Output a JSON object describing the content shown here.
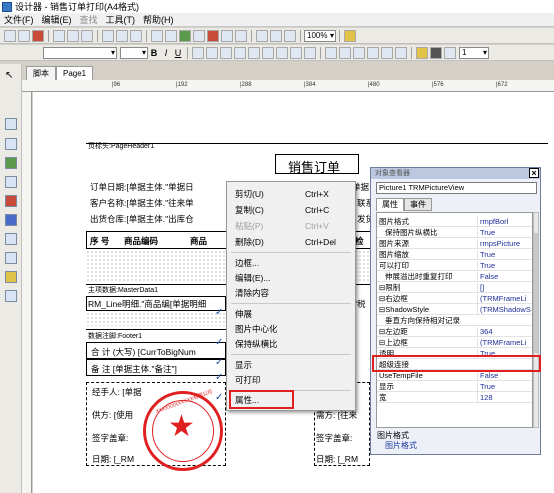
{
  "window": {
    "title": "设计器 - 销售订单打印(A4格式)"
  },
  "menu": {
    "items": [
      "文件(F)",
      "编辑(E)",
      "查找",
      "工具(T)",
      "帮助(H)"
    ]
  },
  "toolbar": {
    "zoom": "100%",
    "size": "1"
  },
  "tabs": [
    "脚本",
    "Page1"
  ],
  "ruler": {
    "marks": [
      "|96",
      "|192",
      "|288",
      "|384",
      "|480",
      "|576",
      "|672"
    ]
  },
  "report": {
    "page_header": "页标头:PageHeader1",
    "title": "销售订单",
    "fields": {
      "order_date": "订单日期:[单据主体.\"单据日",
      "customer": "客户名称:[单据主体.\"往来单",
      "warehouse": "出货仓库:[单据主体.\"出库仓",
      "r1": "单据",
      "r2": "联系",
      "r3": "发货"
    },
    "table_headers": [
      "序 号",
      "商品编码",
      "商品",
      "检"
    ],
    "master_band": "主项数据:MasterData1",
    "master_row": "RM_Line明细.\"商品编[单据明细",
    "master_tax": "\"税",
    "footer_band": "数据注脚:Footer1",
    "total": "合 计 (大写) [CurrToBigNum",
    "remark": "备 注 [单据主体.\"备注\"]",
    "handler": "经手人: [单据",
    "supplier": "供方: [使用",
    "demand": "需方: [往来",
    "sign1": "签字盖章:",
    "sign2": "签字盖章:",
    "date1": "日期: [_RM",
    "date2": "日期: [_RM",
    "stamp_text": "XXXXXXXXXXXX有限公司"
  },
  "context_menu": {
    "items": [
      {
        "label": "剪切(U)",
        "shortcut": "Ctrl+X"
      },
      {
        "label": "复制(C)",
        "shortcut": "Ctrl+C"
      },
      {
        "label": "粘贴(P)",
        "shortcut": "Ctrl+V"
      },
      {
        "label": "删除(D)",
        "shortcut": "Ctrl+Del"
      },
      {
        "label": "边框..."
      },
      {
        "label": "编辑(E)..."
      },
      {
        "label": "清除内容"
      },
      {
        "label": "伸展"
      },
      {
        "label": "图片中心化"
      },
      {
        "label": "保持纵横比"
      },
      {
        "label": "显示"
      },
      {
        "label": "可打印"
      },
      {
        "label": "属性..."
      }
    ]
  },
  "inspector": {
    "title": "对象查看器",
    "object": "Picture1    TRMPictureView",
    "tabs": [
      "属性",
      "事件"
    ],
    "rows": [
      {
        "name": "图片格式",
        "value": "rmpfBorl"
      },
      {
        "name": "保持图片纵横比",
        "value": "True"
      },
      {
        "name": "图片来源",
        "value": "rmpsPicture"
      },
      {
        "name": "图片缩放",
        "value": "True"
      },
      {
        "name": "可以打印",
        "value": "True"
      },
      {
        "name": "伸展溢出时重复打印",
        "value": "False"
      },
      {
        "name": "⊟限制",
        "value": "[]"
      },
      {
        "name": "⊟右边框",
        "value": "(TRMFrameLi"
      },
      {
        "name": "⊟ShadowStyle",
        "value": "(TRMShadowS"
      },
      {
        "name": "垂直方向保持相对记录",
        "value": ""
      },
      {
        "name": "⊟左边距",
        "value": "364"
      },
      {
        "name": "⊟上边框",
        "value": "(TRMFrameLi"
      },
      {
        "name": "透明",
        "value": "True"
      },
      {
        "name": "超级连接",
        "value": ""
      },
      {
        "name": "UseTempFile",
        "value": "False"
      },
      {
        "name": "显示",
        "value": "True"
      },
      {
        "name": "宽",
        "value": "128"
      }
    ],
    "desc_title": "图片格式",
    "desc_value": "图片格式"
  }
}
